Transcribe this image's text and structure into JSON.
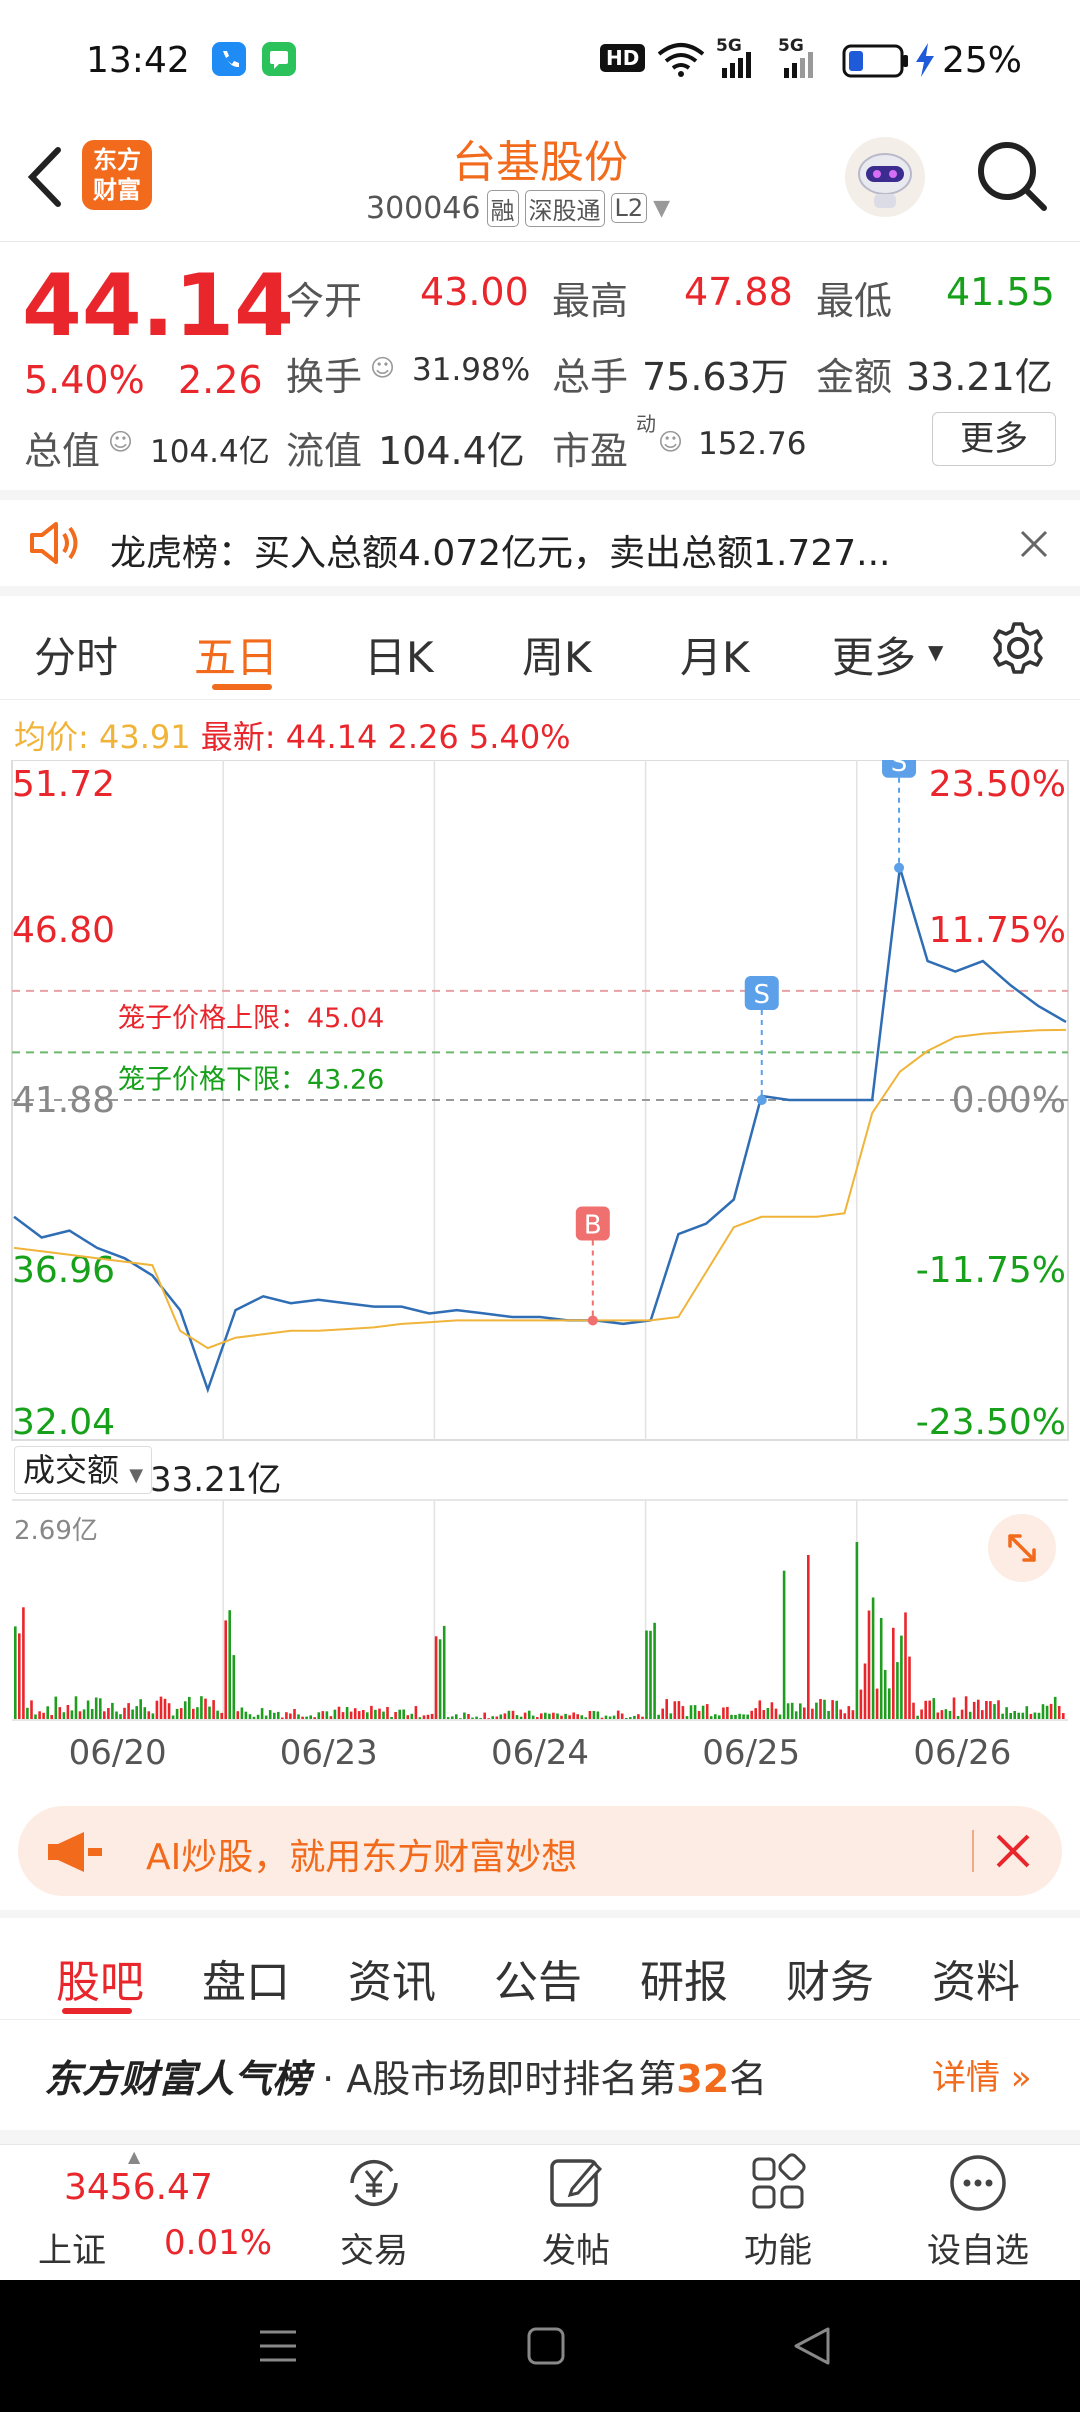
{
  "status_bar": {
    "time": "13:42",
    "battery": "25%",
    "hd": "HD",
    "signal1": "5G",
    "signal2": "5G"
  },
  "header": {
    "logo_line1": "东方",
    "logo_line2": "财富",
    "title": "台基股份",
    "code": "300046",
    "badges": [
      "融",
      "深股通",
      "L2"
    ]
  },
  "quote": {
    "price": "44.14",
    "change_pct": "5.40%",
    "change": "2.26",
    "open_label": "今开",
    "open": "43.00",
    "high_label": "最高",
    "high": "47.88",
    "low_label": "最低",
    "low": "41.55",
    "turnover_label": "换手",
    "turnover": "31.98%",
    "volume_label": "总手",
    "volume": "75.63万",
    "amount_label": "金额",
    "amount": "33.21亿",
    "mktcap_label": "总值",
    "mktcap": "104.4亿",
    "float_label": "流值",
    "float_cap": "104.4亿",
    "pe_label": "市盈",
    "pe_sup": "动",
    "pe": "152.76",
    "more_button": "更多"
  },
  "notice": {
    "text": "龙虎榜：买入总额4.072亿元，卖出总额1.727..."
  },
  "period_tabs": [
    "分时",
    "五日",
    "日K",
    "周K",
    "月K",
    "更多"
  ],
  "active_period": 1,
  "avg_line": {
    "avg_label": "均价:",
    "avg": "43.91",
    "latest_label": "最新:",
    "latest": "44.14",
    "change": "2.26",
    "pct": "5.40%"
  },
  "chart_data": {
    "type": "line",
    "title": "",
    "prev_close": 41.88,
    "y_ticks_left": [
      "51.72",
      "46.80",
      "41.88",
      "36.96",
      "32.04"
    ],
    "y_ticks_right": [
      "23.50%",
      "11.75%",
      "0.00%",
      "-11.75%",
      "-23.50%"
    ],
    "ylim": [
      32.04,
      51.72
    ],
    "x_ticks": [
      "06/20",
      "06/23",
      "06/24",
      "06/25",
      "06/26"
    ],
    "series": [
      {
        "values": [
          38.5,
          37.9,
          38.1,
          37.6,
          37.3,
          36.8,
          35.8,
          33.5,
          35.8,
          36.2,
          36.0,
          36.1,
          36.0,
          35.9,
          35.9,
          35.7,
          35.8,
          35.7,
          35.6,
          35.6,
          35.5,
          35.5,
          35.4,
          35.5,
          38.0,
          38.3,
          39.0,
          42.0,
          41.88,
          41.88,
          41.88,
          41.88,
          48.6,
          45.9,
          45.6,
          45.9,
          45.2,
          44.6,
          44.14
        ]
      },
      {
        "values": [
          37.6,
          37.5,
          37.4,
          37.3,
          37.2,
          37.1,
          35.2,
          34.7,
          35.0,
          35.1,
          35.2,
          35.2,
          35.25,
          35.3,
          35.4,
          35.45,
          35.5,
          35.5,
          35.5,
          35.5,
          35.5,
          35.5,
          35.5,
          35.5,
          35.6,
          36.9,
          38.2,
          38.5,
          38.5,
          38.5,
          38.6,
          41.5,
          42.7,
          43.3,
          43.7,
          43.8,
          43.85,
          43.9,
          43.91
        ]
      }
    ],
    "cage_upper_label": "笼子价格上限：45.04",
    "cage_upper": 45.04,
    "cage_lower_label": "笼子价格下限：43.26",
    "cage_lower": 43.26,
    "markers": [
      {
        "label": "B",
        "price": 35.5,
        "day": 2.75
      },
      {
        "label": "S",
        "price": 41.88,
        "day": 3.55
      },
      {
        "label": "S",
        "price": 48.6,
        "day": 4.2
      }
    ],
    "grid": true
  },
  "volume": {
    "label": "成交额",
    "value": "33.21亿",
    "max": "2.69亿"
  },
  "ai_banner": {
    "text": "AI炒股，就用东方财富妙想"
  },
  "sub_tabs": [
    "股吧",
    "盘口",
    "资讯",
    "公告",
    "研报",
    "财务",
    "资料"
  ],
  "rank": {
    "title": "东方财富人气榜",
    "text_pre": "· A股市场即时排名第",
    "rank": "32",
    "text_post": "名",
    "detail": "详情"
  },
  "bottom": {
    "index_value": "3456.47",
    "index_name": "上证",
    "index_pct": "0.01%",
    "items": [
      "交易",
      "发帖",
      "功能",
      "设自选"
    ]
  },
  "colors": {
    "red": "#e8262c",
    "green": "#17a01a",
    "orange": "#f26a1b",
    "price_line": "#2f6db5",
    "avg_line": "#f0b43a"
  }
}
